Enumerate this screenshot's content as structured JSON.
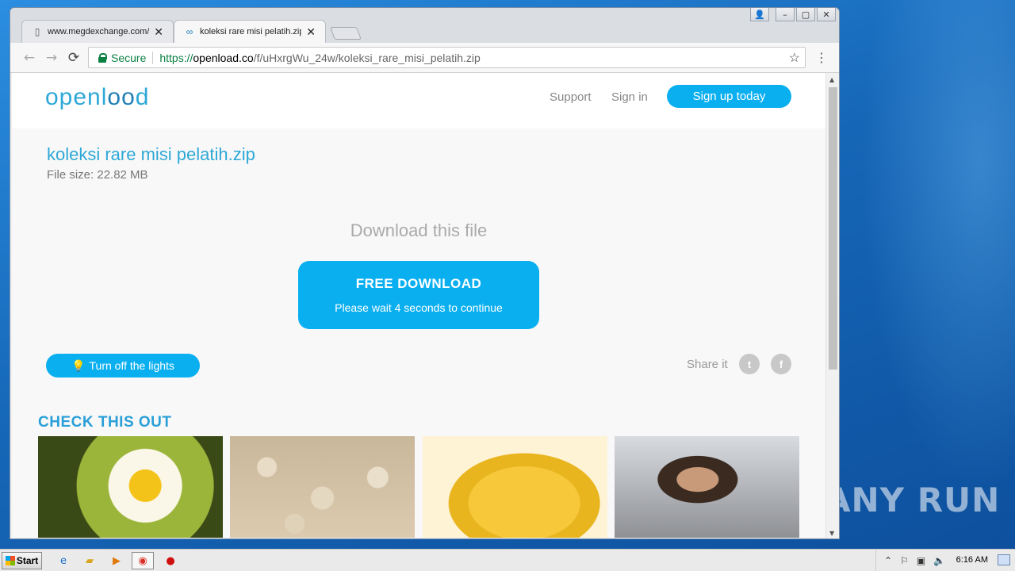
{
  "desktop": {
    "watermark": "ANY RUN"
  },
  "window": {
    "controls": {
      "user": "👤",
      "minimize": "–",
      "maximize": "▢",
      "close": "✕"
    }
  },
  "tabs": [
    {
      "label": "www.megdexchange.com/jt",
      "close": "✕"
    },
    {
      "label": "koleksi rare misi pelatih.zip |",
      "close": "✕"
    }
  ],
  "toolbar": {
    "back": "←",
    "forward": "→",
    "reload": "⟳",
    "secure_label": "Secure",
    "url_scheme": "https://",
    "url_host": "openload.co",
    "url_path": "/f/uHxrgWu_24w/koleksi_rare_misi_pelatih.zip",
    "star": "☆",
    "menu": "⋮"
  },
  "site": {
    "logo_left": "openl",
    "logo_mid": "oo",
    "logo_right": "d",
    "nav": {
      "support": "Support",
      "signin": "Sign in",
      "signup": "Sign up today"
    },
    "file": {
      "name": "koleksi rare misi pelatih.zip",
      "size": "File size: 22.82 MB"
    },
    "download_title": "Download this file",
    "download_button": {
      "label": "FREE DOWNLOAD",
      "sublabel": "Please wait 4 seconds to continue"
    },
    "lights_button": "Turn off the lights",
    "share_label": "Share it",
    "social": {
      "twitter": "t",
      "facebook": "f"
    },
    "check_title": "CHECK THIS OUT"
  },
  "taskbar": {
    "start": "Start",
    "clock": "6:16 AM"
  },
  "colors": {
    "brand": "#0aaff0",
    "logo": "#2ea8d6",
    "secure": "#0b8043"
  }
}
